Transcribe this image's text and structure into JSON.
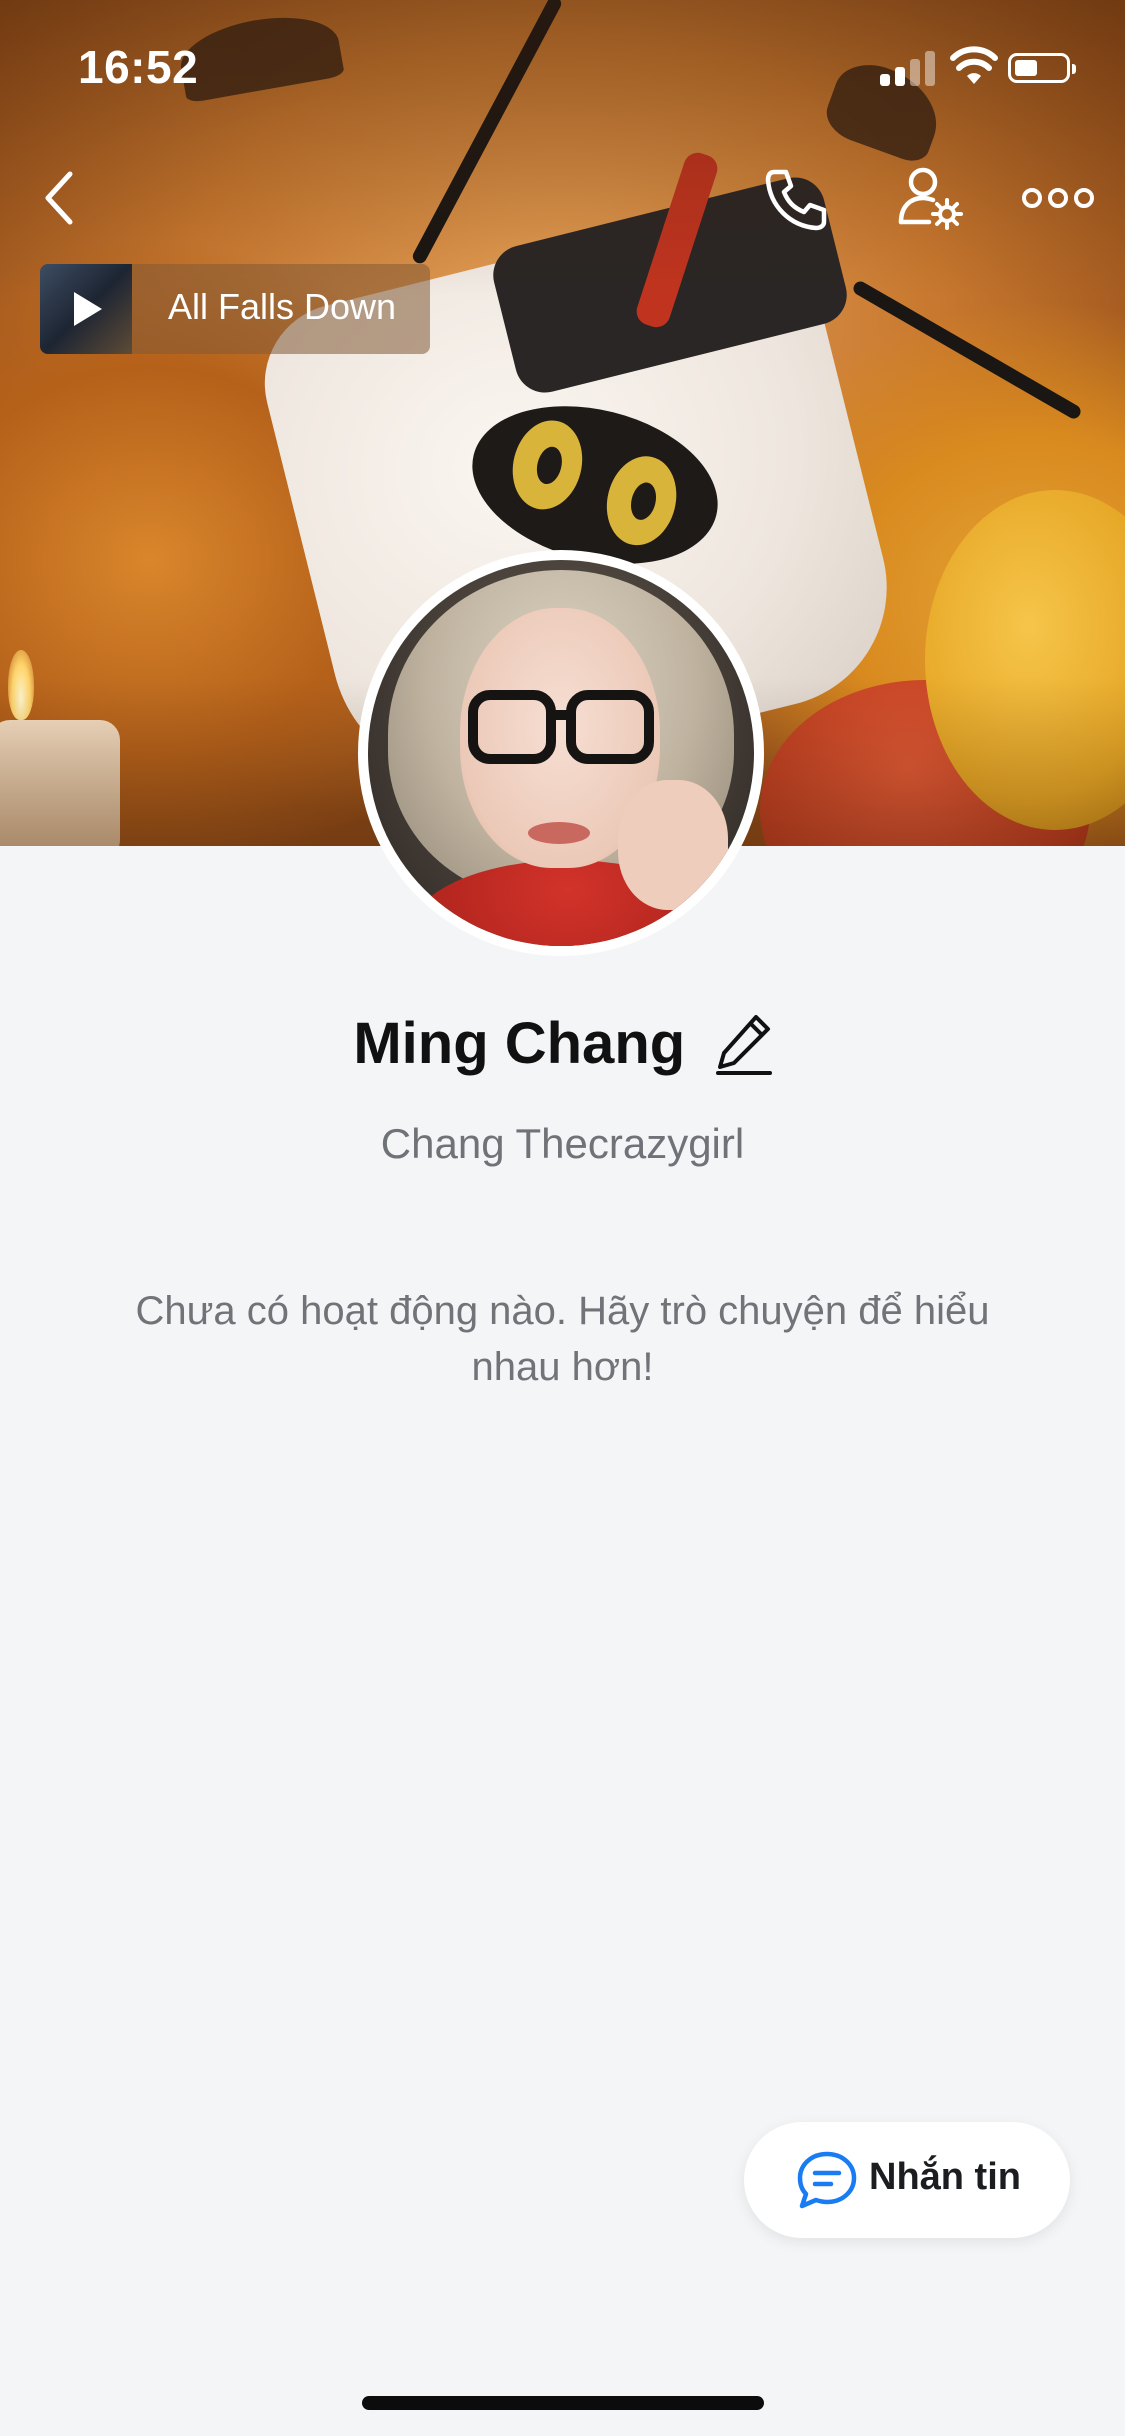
{
  "status_bar": {
    "time": "16:52",
    "signal_icon": "cellular-signal-icon",
    "wifi_icon": "wifi-icon",
    "battery_icon": "battery-icon",
    "battery_level": 0.45
  },
  "top_nav": {
    "back_icon": "chevron-left-icon",
    "call_icon": "phone-icon",
    "profile_settings_icon": "user-gear-icon",
    "more_icon": "more-horizontal-icon"
  },
  "cover": {
    "music": {
      "title": "All Falls Down",
      "play_icon": "play-icon"
    }
  },
  "profile": {
    "display_name": "Ming Chang",
    "edit_icon": "pencil-icon",
    "username": "Chang Thecrazygirl",
    "empty_activity_message": "Chưa có hoạt động nào. Hãy trò chuyện để hiểu nhau hơn!"
  },
  "message_button": {
    "label": "Nhắn tin",
    "icon": "chat-bubble-icon",
    "icon_color": "#1a7cf2"
  }
}
